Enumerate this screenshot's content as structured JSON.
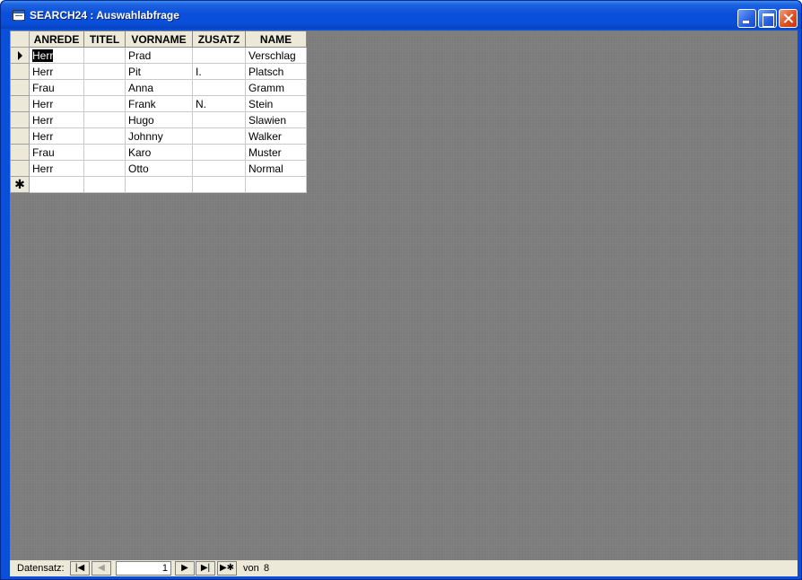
{
  "window": {
    "title": "SEARCH24 : Auswahlabfrage"
  },
  "columns": [
    "ANREDE",
    "TITEL",
    "VORNAME",
    "ZUSATZ",
    "NAME"
  ],
  "rows": [
    {
      "anrede": "Herr",
      "titel": "",
      "vorname": "Prad",
      "zusatz": "",
      "name": "Verschlag"
    },
    {
      "anrede": "Herr",
      "titel": "",
      "vorname": "Pit",
      "zusatz": "I.",
      "name": "Platsch"
    },
    {
      "anrede": "Frau",
      "titel": "",
      "vorname": "Anna",
      "zusatz": "",
      "name": "Gramm"
    },
    {
      "anrede": "Herr",
      "titel": "",
      "vorname": "Frank",
      "zusatz": "N.",
      "name": "Stein"
    },
    {
      "anrede": "Herr",
      "titel": "",
      "vorname": "Hugo",
      "zusatz": "",
      "name": "Slawien"
    },
    {
      "anrede": "Herr",
      "titel": "",
      "vorname": "Johnny",
      "zusatz": "",
      "name": "Walker"
    },
    {
      "anrede": "Frau",
      "titel": "",
      "vorname": "Karo",
      "zusatz": "",
      "name": "Muster"
    },
    {
      "anrede": "Herr",
      "titel": "",
      "vorname": "Otto",
      "zusatz": "",
      "name": "Normal"
    }
  ],
  "navigation": {
    "label": "Datensatz:",
    "current_record": "1",
    "of_label": "von",
    "total": "8"
  },
  "icons": {
    "record_selector": "arrow-right-icon",
    "new_record": "asterisk-icon"
  }
}
